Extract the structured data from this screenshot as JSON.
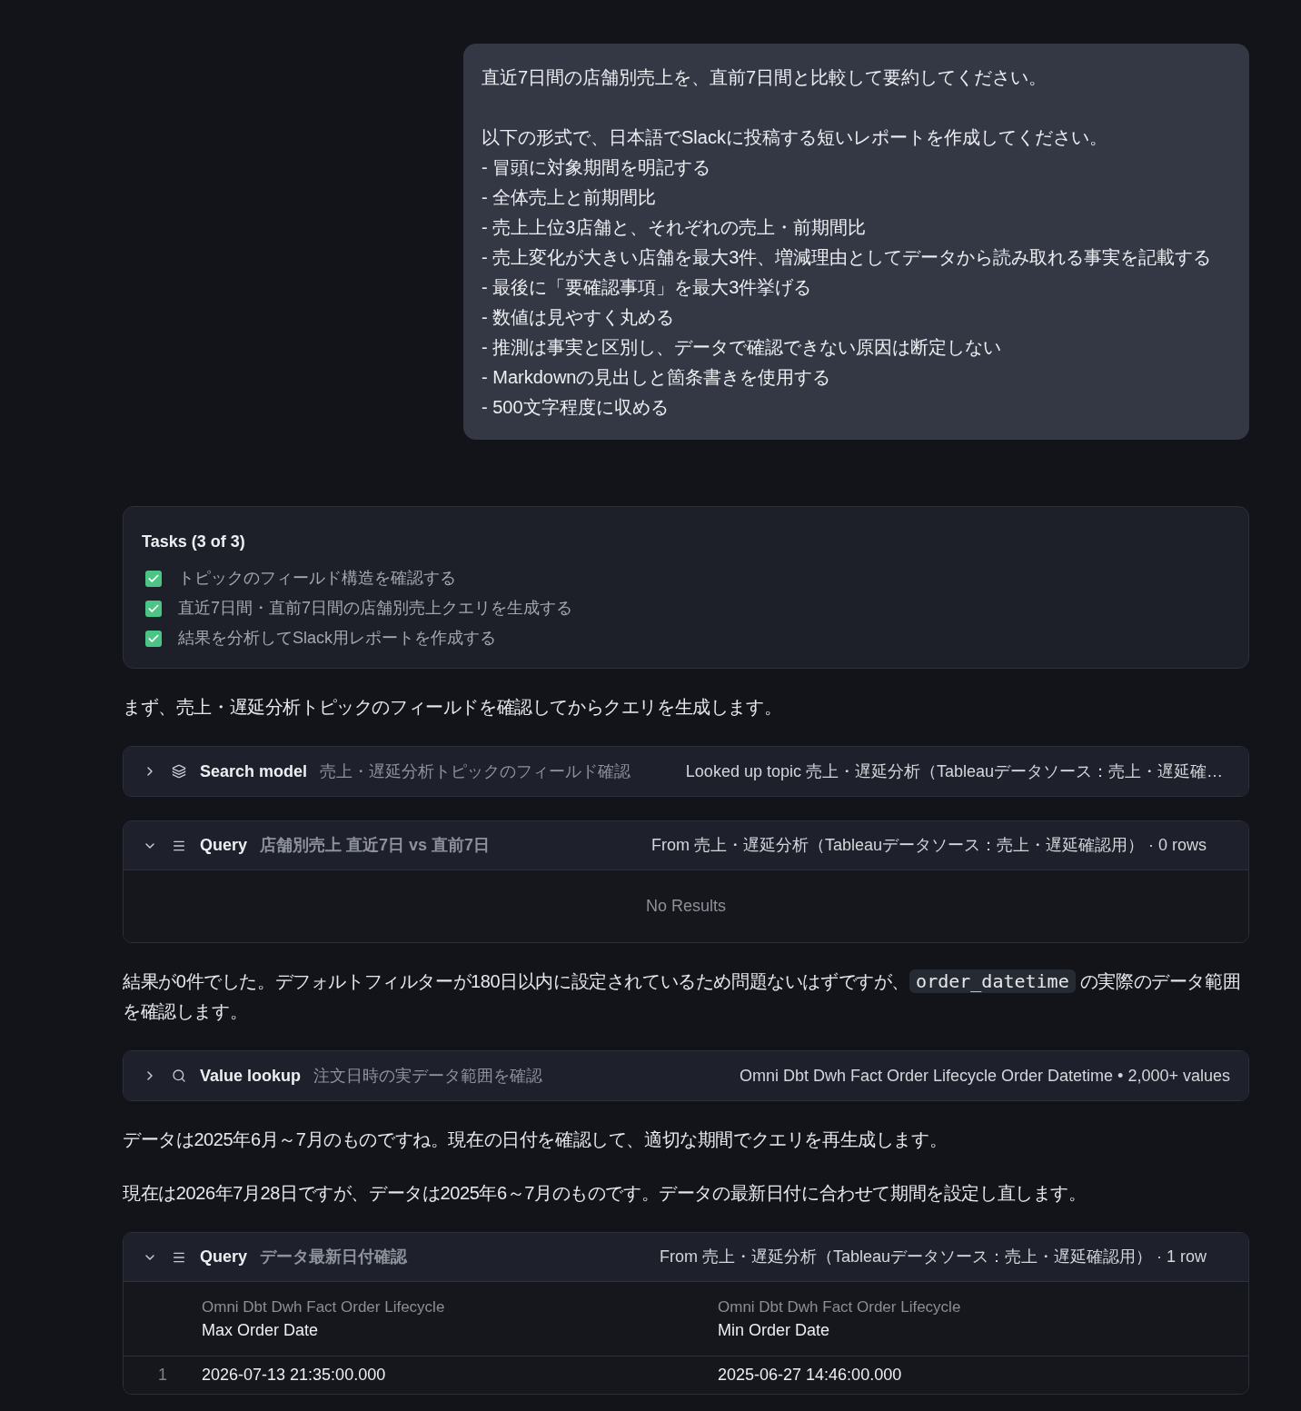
{
  "user_message": {
    "paragraphs": [
      [
        "直近7日間の店舗別売上を、直前7日間と比較して要約してください。"
      ],
      [
        "以下の形式で、日本語でSlackに投稿する短いレポートを作成してください。",
        "- 冒頭に対象期間を明記する",
        "- 全体売上と前期間比",
        "- 売上上位3店舗と、それぞれの売上・前期間比",
        "- 売上変化が大きい店舗を最大3件、増減理由としてデータから読み取れる事実を記載する",
        "- 最後に「要確認事項」を最大3件挙げる",
        "- 数値は見やすく丸める",
        "- 推測は事実と区別し、データで確認できない原因は断定しない",
        "- Markdownの見出しと箇条書きを使用する",
        "- 500文字程度に収める"
      ]
    ]
  },
  "tasks": {
    "title": "Tasks (3 of 3)",
    "items": [
      {
        "label": "トピックのフィールド構造を確認する",
        "checked": true
      },
      {
        "label": "直近7日間・直前7日間の店舗別売上クエリを生成する",
        "checked": true
      },
      {
        "label": "結果を分析してSlack用レポートを作成する",
        "checked": true
      }
    ]
  },
  "blocks": [
    {
      "kind": "paragraph",
      "segments": [
        {
          "kind": "text",
          "text": "まず、売上・遅延分析トピックのフィールドを確認してからクエリを生成します。"
        }
      ]
    },
    {
      "kind": "search_model",
      "expanded": false,
      "title": "Search model",
      "subtitle": "売上・遅延分析トピックのフィールド確認",
      "summary": "Looked up topic 売上・遅延分析（Tableauデータソース：売上・遅延確…"
    },
    {
      "kind": "query",
      "expanded": true,
      "title": "Query",
      "subtitle": "店舗別売上 直近7日 vs 直前7日",
      "summary": "From 売上・遅延分析（Tableauデータソース：売上・遅延確認用） · 0 rows",
      "result": {
        "kind": "empty",
        "text": "No Results"
      }
    },
    {
      "kind": "paragraph",
      "segments": [
        {
          "kind": "text",
          "text": "結果が0件でした。デフォルトフィルターが180日以内に設定されているため問題ないはずですが、"
        },
        {
          "kind": "code",
          "text": "order_datetime"
        },
        {
          "kind": "text",
          "text": " の実際のデータ範囲を確認します。"
        }
      ]
    },
    {
      "kind": "value_lookup",
      "expanded": false,
      "title": "Value lookup",
      "subtitle": "注文日時の実データ範囲を確認",
      "summary": "Omni Dbt Dwh Fact Order Lifecycle Order Datetime • 2,000+ values"
    },
    {
      "kind": "paragraph",
      "segments": [
        {
          "kind": "text",
          "text": "データは2025年6月～7月のものですね。現在の日付を確認して、適切な期間でクエリを再生成します。"
        }
      ]
    },
    {
      "kind": "paragraph",
      "segments": [
        {
          "kind": "text",
          "text": "現在は2026年7月28日ですが、データは2025年6～7月のものです。データの最新日付に合わせて期間を設定し直します。"
        }
      ]
    },
    {
      "kind": "query",
      "expanded": true,
      "title": "Query",
      "subtitle": "データ最新日付確認",
      "summary": "From 売上・遅延分析（Tableauデータソース：売上・遅延確認用） · 1 row",
      "result": {
        "kind": "table",
        "columns": [
          {
            "group": "Omni Dbt Dwh Fact Order Lifecycle",
            "label": "Max Order Date"
          },
          {
            "group": "Omni Dbt Dwh Fact Order Lifecycle",
            "label": "Min Order Date"
          }
        ],
        "rows": [
          {
            "number": "1",
            "cells": [
              "2026-07-13 21:35:00.000",
              "2025-06-27 14:46:00.000"
            ]
          }
        ]
      }
    }
  ]
}
